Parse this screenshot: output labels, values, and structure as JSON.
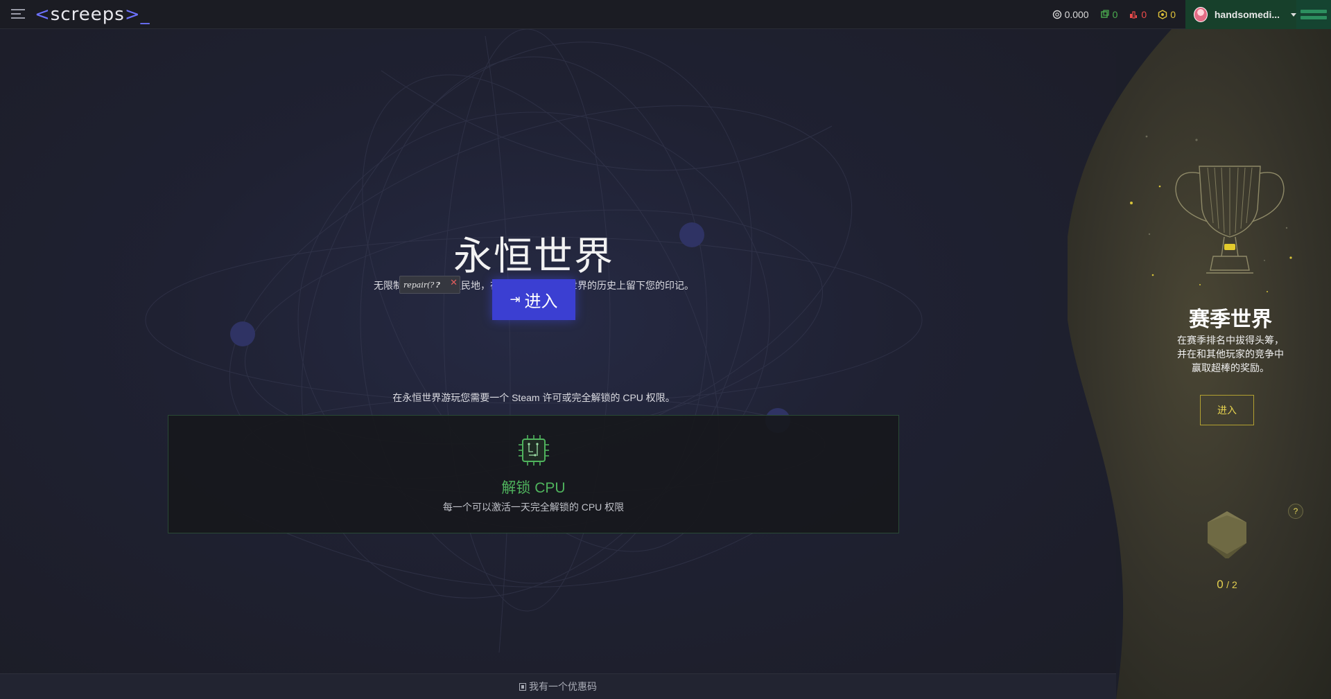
{
  "header": {
    "logo": {
      "left": "<",
      "text": "screeps",
      "right": ">_"
    },
    "stats": {
      "cpu": "0.000",
      "green_count": "0",
      "red_count": "0",
      "yellow_count": "0"
    },
    "user": {
      "name": "handsomedi..."
    }
  },
  "main": {
    "title": "永恒世界",
    "subtitle": "无限制地发展您的殖民地，在这个巨大的永恒世界的历史上留下您的印记。",
    "repair_chip": "repair(?",
    "repair_chip_bold": "?",
    "enter_button": "进入",
    "steam_note": "在永恒世界游玩您需要一个 Steam 许可或完全解锁的 CPU 权限。",
    "unlock": {
      "title": "解锁 CPU",
      "description": "每一个可以激活一天完全解锁的 CPU 权限"
    }
  },
  "footer": {
    "promo": "我有一个优惠码"
  },
  "season": {
    "title": "赛季世界",
    "description_lines": [
      "在赛季排名中拔得头筹，",
      "并在和其他玩家的竞争中",
      "赢取超棒的奖励。"
    ],
    "enter_button": "进入",
    "help": "?",
    "progress_current": "0",
    "progress_total": "/ 2"
  },
  "colors": {
    "accent_blue": "#3b3fd2",
    "unlock_green": "#4fb35d",
    "season_gold": "#e4d04f",
    "user_bg": "#17402b"
  }
}
